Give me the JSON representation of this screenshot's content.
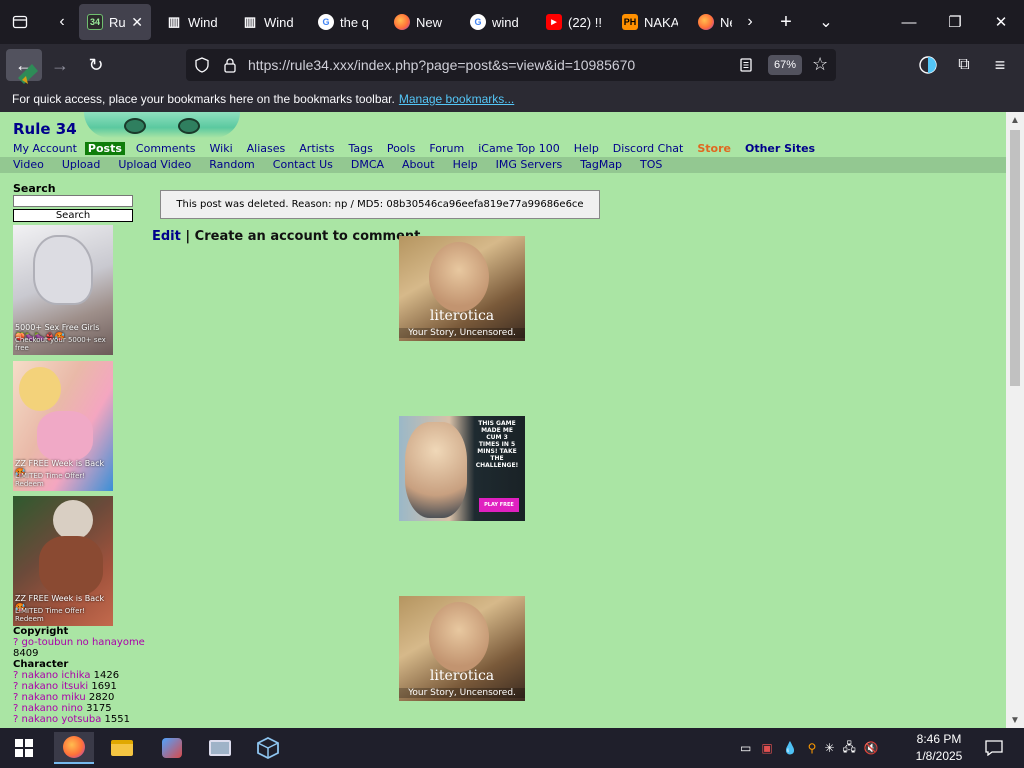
{
  "browser": {
    "tabs": [
      {
        "label": "Rul",
        "favicon": "34",
        "favicon_color": "#2b2b2b",
        "active": true
      },
      {
        "label": "Wind",
        "favicon": "library-icon",
        "active": false
      },
      {
        "label": "Wind",
        "favicon": "library-icon",
        "active": false
      },
      {
        "label": "the q",
        "favicon": "google-icon",
        "active": false
      },
      {
        "label": "New",
        "favicon": "firefox-icon",
        "active": false
      },
      {
        "label": "wind",
        "favicon": "google-icon",
        "active": false
      },
      {
        "label": "(22) !!",
        "favicon": "youtube-icon",
        "active": false
      },
      {
        "label": "NAKA",
        "favicon": "PH",
        "active": false
      },
      {
        "label": "Ne",
        "favicon": "firefox-icon",
        "active": false
      }
    ],
    "url": "https://rule34.xxx/index.php?page=post&s=view&id=10985670",
    "zoom": "67%",
    "bookmarks_message": "For quick access, place your bookmarks here on the bookmarks toolbar.",
    "bookmarks_link": "Manage bookmarks..."
  },
  "site": {
    "logo": "Rule 34",
    "menu_primary": [
      "My Account",
      "Posts",
      "Comments",
      "Wiki",
      "Aliases",
      "Artists",
      "Tags",
      "Pools",
      "Forum",
      "iCame Top 100",
      "Help",
      "Discord Chat",
      "Store",
      "Other Sites"
    ],
    "menu_secondary": [
      "Video",
      "Upload",
      "Upload Video",
      "Random",
      "Contact Us",
      "DMCA",
      "About",
      "Help",
      "IMG Servers",
      "TagMap",
      "TOS"
    ],
    "search": {
      "label": "Search",
      "button": "Search",
      "value": ""
    },
    "side_ads": [
      {
        "caption": "5000+ Sex Free Girls 🍑🍆🍆👙🥵",
        "sub": "Checkout your 5000+ sex free"
      },
      {
        "caption": "ZZ FREE Week is Back🥵",
        "sub": "LIMITED Time Offer! Redeem"
      },
      {
        "caption": "ZZ FREE Week is Back🥵",
        "sub": "LIMITED Time Offer! Redeem"
      }
    ],
    "copyright_header": "Copyright",
    "copyright_tags": [
      {
        "q": "?",
        "name": "go-toubun no hanayome",
        "count": "8409"
      }
    ],
    "character_header": "Character",
    "character_tags": [
      {
        "q": "?",
        "name": "nakano ichika",
        "count": "1426"
      },
      {
        "q": "?",
        "name": "nakano itsuki",
        "count": "1691"
      },
      {
        "q": "?",
        "name": "nakano miku",
        "count": "2820"
      },
      {
        "q": "?",
        "name": "nakano nino",
        "count": "3175"
      },
      {
        "q": "?",
        "name": "nakano yotsuba",
        "count": "1551"
      }
    ],
    "notice": "This post was deleted. Reason: np / MD5: 08b30546ca96eefa819e77a99686e6ce",
    "edit": "Edit",
    "sep": "|",
    "create_account": "Create an account to comment",
    "main_ads": [
      {
        "type": "literotica",
        "brand": "literotica",
        "slogan": "Your Story, Uncensored."
      },
      {
        "type": "game",
        "text": "THIS GAME MADE ME CUM 3 TIMES IN 5 MINS! TAKE THE CHALLENGE!",
        "button": "PLAY FREE"
      },
      {
        "type": "literotica",
        "brand": "literotica",
        "slogan": "Your Story, Uncensored."
      }
    ]
  },
  "taskbar": {
    "time": "8:46 PM",
    "date": "1/8/2025"
  }
}
